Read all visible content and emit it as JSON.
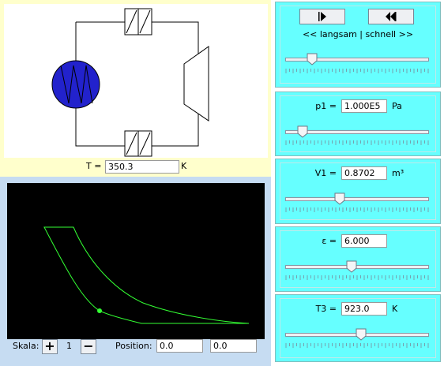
{
  "circuit": {
    "temperature_label": "T =",
    "temperature_value": "350.3",
    "temperature_unit": "K",
    "colors": {
      "generator_fill": "#2222cc",
      "line": "#000000"
    }
  },
  "diagram": {
    "curve_color": "#33ff33",
    "scale_label": "Skala:",
    "scale_value": "1",
    "zoom_in_label": "+",
    "zoom_out_label": "−",
    "position_label": "Position:",
    "position_x": "0.0",
    "position_y": "0.0"
  },
  "controls": {
    "play_icon": "step-play-icon",
    "rewind_icon": "rewind-icon",
    "speed_label": "<< langsam | schnell >>",
    "speed_slider": 0.16
  },
  "parameters": [
    {
      "label": "p1 =",
      "value": "1.000E5",
      "unit": "Pa",
      "slider": 0.09
    },
    {
      "label": "V1 =",
      "value": "0.8702",
      "unit": "m³",
      "slider": 0.37
    },
    {
      "label": "ε =",
      "value": "6.000",
      "unit": "",
      "slider": 0.46
    },
    {
      "label": "T3 =",
      "value": "923.0",
      "unit": "K",
      "slider": 0.53
    }
  ]
}
